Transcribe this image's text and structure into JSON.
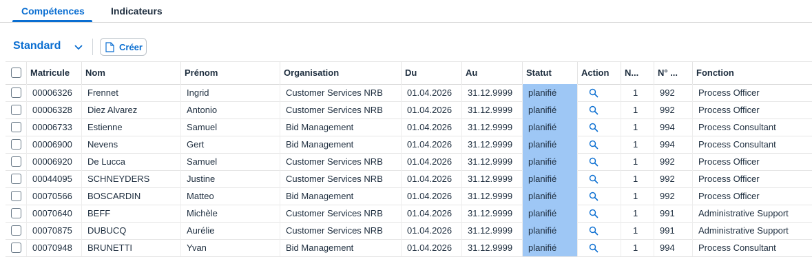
{
  "tabs": [
    {
      "label": "Compétences",
      "active": true
    },
    {
      "label": "Indicateurs",
      "active": false
    }
  ],
  "toolbar": {
    "variant_label": "Standard",
    "variant_icon": "chevron-down-icon",
    "create_label": "Créer",
    "create_icon": "document-add-icon"
  },
  "colors": {
    "accent": "#0a6ed1",
    "status_highlight": "#9ec7f5",
    "text": "#1d2d3e"
  },
  "table": {
    "columns": [
      "Matricule",
      "Nom",
      "Prénom",
      "Organisation",
      "Du",
      "Au",
      "Statut",
      "Action",
      "N...",
      "N° ...",
      "Fonction"
    ],
    "action_icon": "search-icon",
    "rows": [
      {
        "matricule": "00006326",
        "nom": "Frennet",
        "prenom": "Ingrid",
        "organisation": "Customer Services NRB",
        "du": "01.04.2026",
        "au": "31.12.9999",
        "statut": "planifié",
        "n1": "1",
        "n2": "992",
        "fonction": "Process Officer"
      },
      {
        "matricule": "00006328",
        "nom": "Diez Alvarez",
        "prenom": "Antonio",
        "organisation": "Customer Services NRB",
        "du": "01.04.2026",
        "au": "31.12.9999",
        "statut": "planifié",
        "n1": "1",
        "n2": "992",
        "fonction": "Process Officer"
      },
      {
        "matricule": "00006733",
        "nom": "Estienne",
        "prenom": "Samuel",
        "organisation": "Bid Management",
        "du": "01.04.2026",
        "au": "31.12.9999",
        "statut": "planifié",
        "n1": "1",
        "n2": "994",
        "fonction": "Process Consultant"
      },
      {
        "matricule": "00006900",
        "nom": "Nevens",
        "prenom": "Gert",
        "organisation": "Bid Management",
        "du": "01.04.2026",
        "au": "31.12.9999",
        "statut": "planifié",
        "n1": "1",
        "n2": "994",
        "fonction": "Process Consultant"
      },
      {
        "matricule": "00006920",
        "nom": "De Lucca",
        "prenom": "Samuel",
        "organisation": "Customer Services NRB",
        "du": "01.04.2026",
        "au": "31.12.9999",
        "statut": "planifié",
        "n1": "1",
        "n2": "992",
        "fonction": "Process Officer"
      },
      {
        "matricule": "00044095",
        "nom": "SCHNEYDERS",
        "prenom": "Justine",
        "organisation": "Customer Services NRB",
        "du": "01.04.2026",
        "au": "31.12.9999",
        "statut": "planifié",
        "n1": "1",
        "n2": "992",
        "fonction": "Process Officer"
      },
      {
        "matricule": "00070566",
        "nom": "BOSCARDIN",
        "prenom": "Matteo",
        "organisation": "Bid Management",
        "du": "01.04.2026",
        "au": "31.12.9999",
        "statut": "planifié",
        "n1": "1",
        "n2": "992",
        "fonction": "Process Officer"
      },
      {
        "matricule": "00070640",
        "nom": "BEFF",
        "prenom": "Michèle",
        "organisation": "Customer Services NRB",
        "du": "01.04.2026",
        "au": "31.12.9999",
        "statut": "planifié",
        "n1": "1",
        "n2": "991",
        "fonction": "Administrative Support"
      },
      {
        "matricule": "00070875",
        "nom": "DUBUCQ",
        "prenom": "Aurélie",
        "organisation": "Customer Services NRB",
        "du": "01.04.2026",
        "au": "31.12.9999",
        "statut": "planifié",
        "n1": "1",
        "n2": "991",
        "fonction": "Administrative Support"
      },
      {
        "matricule": "00070948",
        "nom": "BRUNETTI",
        "prenom": "Yvan",
        "organisation": "Bid Management",
        "du": "01.04.2026",
        "au": "31.12.9999",
        "statut": "planifié",
        "n1": "1",
        "n2": "994",
        "fonction": "Process Consultant"
      }
    ]
  }
}
